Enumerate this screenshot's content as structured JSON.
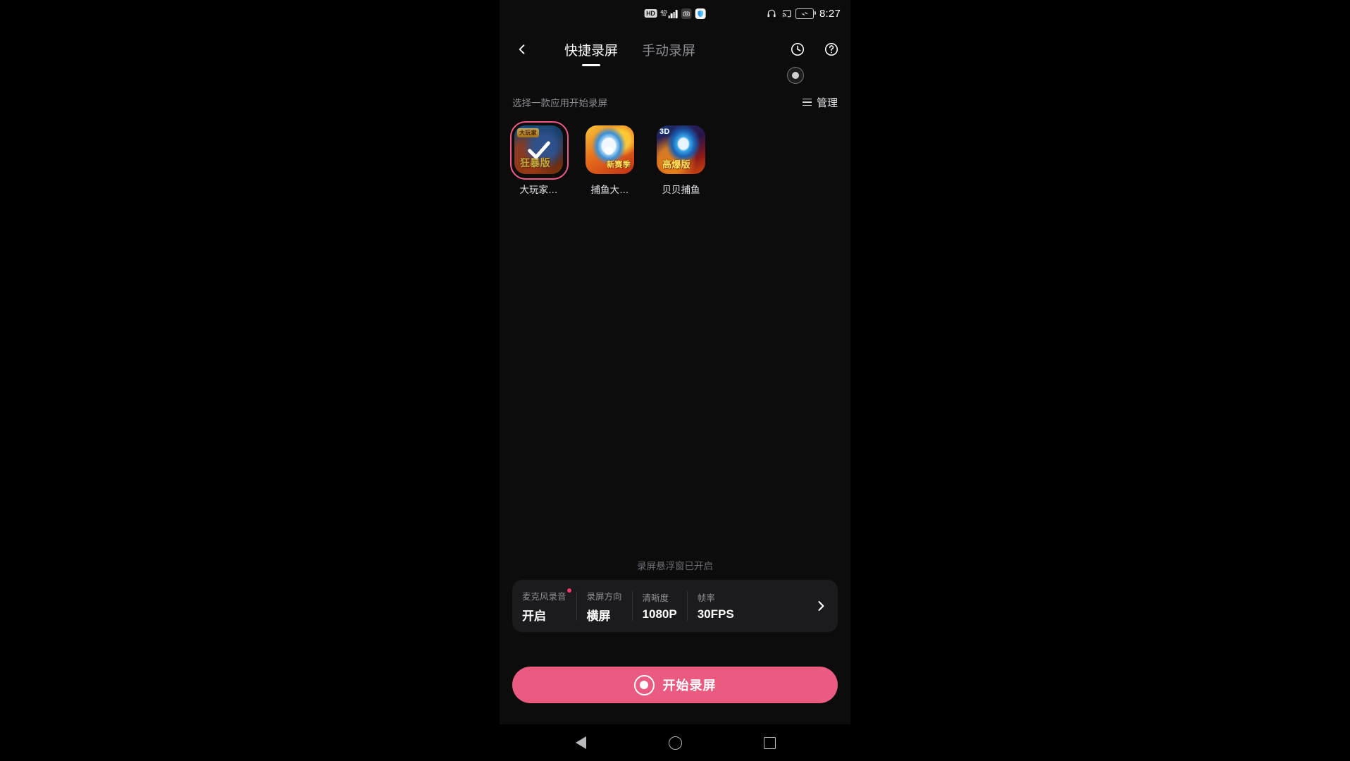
{
  "statusbar": {
    "hd_badge": "HD",
    "network_type": "4G",
    "network_sub": "lte",
    "time": "8:27",
    "icons": {
      "hd": "hd-badge-icon",
      "signal": "signal-bars-icon",
      "app_dark": "app-notification-icon",
      "shield": "security-shield-icon",
      "headphones": "headphones-icon",
      "cast": "screen-cast-icon",
      "battery": "battery-charging-icon"
    }
  },
  "topbar": {
    "back": "back-chevron",
    "tabs": [
      {
        "label": "快捷录屏",
        "active": true
      },
      {
        "label": "手动录屏",
        "active": false
      }
    ],
    "history_icon": "clock-history-icon",
    "help_icon": "question-help-icon"
  },
  "float_widget": {
    "name": "floating-record-dot"
  },
  "section": {
    "title": "选择一款应用开始录屏",
    "manage_label": "管理",
    "manage_icon": "list-menu-icon"
  },
  "apps": [
    {
      "label": "大玩家…",
      "selected": true,
      "badge_top": "大玩家",
      "badge_bottom": "狂暴版",
      "icon_name": "app-icon-dawanjia"
    },
    {
      "label": "捕鱼大…",
      "selected": false,
      "badge_top": "",
      "badge_bottom": "新赛季",
      "icon_name": "app-icon-buyuda"
    },
    {
      "label": "贝贝捕鱼",
      "selected": false,
      "badge_top": "3D",
      "badge_bottom": "高爆版",
      "icon_name": "app-icon-beibeibuyu"
    }
  ],
  "float_hint": "录屏悬浮窗已开启",
  "settings": [
    {
      "key": "麦克风录音",
      "value": "开启",
      "dot": true
    },
    {
      "key": "录屏方向",
      "value": "横屏",
      "dot": false
    },
    {
      "key": "清晰度",
      "value": "1080P",
      "dot": false
    },
    {
      "key": "帧率",
      "value": "30FPS",
      "dot": false
    }
  ],
  "settings_chevron": "settings-more-chevron",
  "record_button": {
    "label": "开始录屏",
    "icon": "record-circle-icon",
    "color": "#eb5a80"
  },
  "navbar": {
    "back": "nav-back-triangle",
    "home": "nav-home-circle",
    "recents": "nav-recents-square"
  },
  "colors": {
    "accent_pink": "#eb5a80",
    "selection_border": "#ef5b86",
    "red_dot": "#f0366c",
    "panel_bg": "#1b1b1d",
    "screen_bg": "#0c0c0d"
  }
}
